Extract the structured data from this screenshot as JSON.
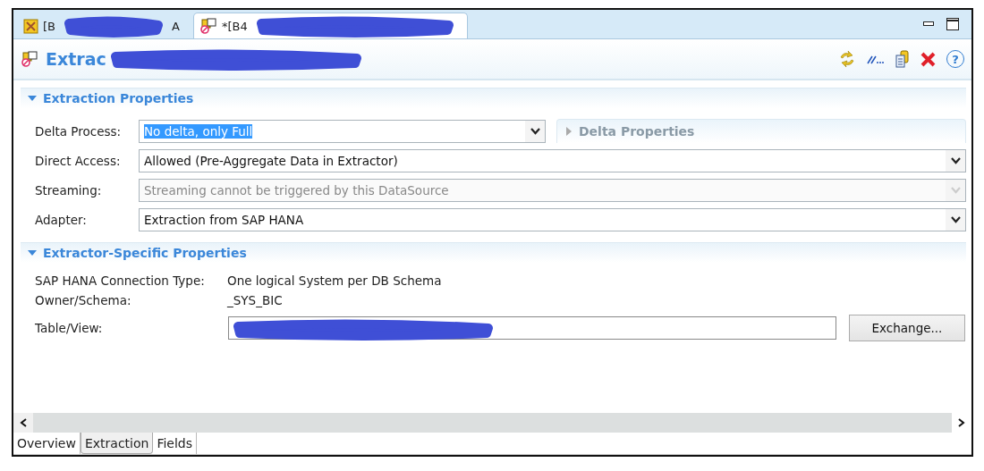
{
  "editor_tabs": [
    {
      "label_start": "[B",
      "label_end": "A",
      "selected": false,
      "redacted": true
    },
    {
      "label_start": "*[B4",
      "selected": true,
      "redacted": true
    }
  ],
  "title": {
    "text": "Extrac",
    "redacted": true
  },
  "help_button": {
    "label": "?"
  },
  "extraction_properties": {
    "title": "Extraction Properties",
    "expanded": true,
    "fields": [
      {
        "label": "Delta Process:",
        "value": "No delta, only Full",
        "disabled": false,
        "highlighted": true
      },
      {
        "label": "Direct Access:",
        "value": "Allowed (Pre-Aggregate Data in Extractor)",
        "disabled": false,
        "highlighted": false
      },
      {
        "label": "Streaming:",
        "value": "Streaming cannot be triggered by this DataSource",
        "disabled": true,
        "highlighted": false
      },
      {
        "label": "Adapter:",
        "value": "Extraction from SAP HANA",
        "disabled": false,
        "highlighted": false
      }
    ],
    "delta_properties": {
      "title": "Delta Properties",
      "expanded": false,
      "disabled": true
    }
  },
  "extractor_specific_properties": {
    "title": "Extractor-Specific Properties",
    "expanded": true,
    "rows": [
      {
        "label": "SAP HANA Connection Type:",
        "value": "One logical System per DB Schema"
      },
      {
        "label": "Owner/Schema:",
        "value": "_SYS_BIC"
      }
    ],
    "table_view": {
      "label": "Table/View:",
      "redacted": true,
      "button": "Exchange..."
    }
  },
  "bottom_tabs": [
    {
      "label": "Overview",
      "selected": false
    },
    {
      "label": "Extraction",
      "selected": true
    },
    {
      "label": "Fields",
      "selected": false
    }
  ]
}
